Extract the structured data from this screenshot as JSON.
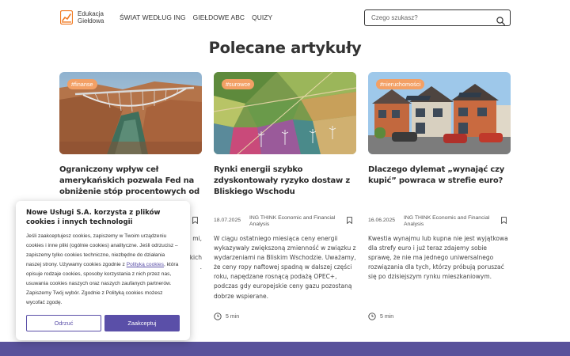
{
  "header": {
    "logo_line1": "Edukacja",
    "logo_line2": "Giełdowa",
    "nav": [
      "ŚWIAT WEDŁUG ING",
      "GIEŁDOWE ABC",
      "QUIZY"
    ],
    "search_placeholder": "Czego szukasz?"
  },
  "section_title": "Polecane artykuły",
  "cards": [
    {
      "tag": "#finanse",
      "title": "Ograniczony wpływ ceł amerykańskich pozwala Fed na obniżenie stóp procentowych od",
      "excerpt_tail": [
        "mi,",
        "kich",
        "."
      ],
      "image": "bridge-canyon"
    },
    {
      "tag": "#surowce",
      "title": "Rynki energii szybko zdyskontowały ryzyko dostaw z Bliskiego Wschodu",
      "date": "18.07.2025",
      "author": "ING THINK Economic and Financial Analysis",
      "excerpt": "W ciągu ostatniego miesiąca ceny energii wykazywały zwiększoną zmienność w związku z wydarzeniami na Bliskim Wschodzie. Uważamy, że ceny ropy naftowej spadną w dalszej części roku, napędzane rosnącą podażą OPEC+, podczas gdy europejskie ceny gazu pozostaną dobrze wspierane.",
      "read_time": "5 min",
      "image": "aerial-fields"
    },
    {
      "tag": "#nieruchomości",
      "title": "Dlaczego dylemat „wynająć czy kupić” powraca w strefie euro?",
      "date": "16.06.2025",
      "author": "ING THINK Economic and Financial Analysis",
      "excerpt": "Kwestia wynajmu lub kupna nie jest wyjątkowa dla strefy euro i już teraz zdajemy sobie sprawę, że nie ma jednego uniwersalnego rozwiązania dla tych, którzy próbują poruszać się po dzisiejszym rynku mieszkaniowym.",
      "read_time": "5 min",
      "image": "row-houses"
    }
  ],
  "cookie": {
    "title": "Nowe Usługi S.A. korzysta z plików cookies i innych technologii",
    "text_before_link": "Jeśli zaakceptujesz cookies, zapiszemy w Twoim urządzeniu cookies i inne pliki (ogólnie cookies) analityczne. Jeśli odrzucisz – zapiszemy tylko cookies techniczne, niezbędne do działania naszej strony. Używamy cookies zgodnie z ",
    "link_text": "Polityką cookies",
    "text_after_link": ", która opisuje rodzaje cookies, sposoby korzystania z nich przez nas, usuwania cookies naszych oraz naszych zaufanych partnerów. Zapiszemy Twój wybór. Zgodnie z Polityką cookies możesz wycofać zgodę.",
    "reject_label": "Odrzuć",
    "accept_label": "Zaakceptuj"
  },
  "colors": {
    "accent": "#5a4fa8",
    "tag": "#f3a065",
    "footer": "#59529b",
    "logo_orange": "#f07a23"
  }
}
